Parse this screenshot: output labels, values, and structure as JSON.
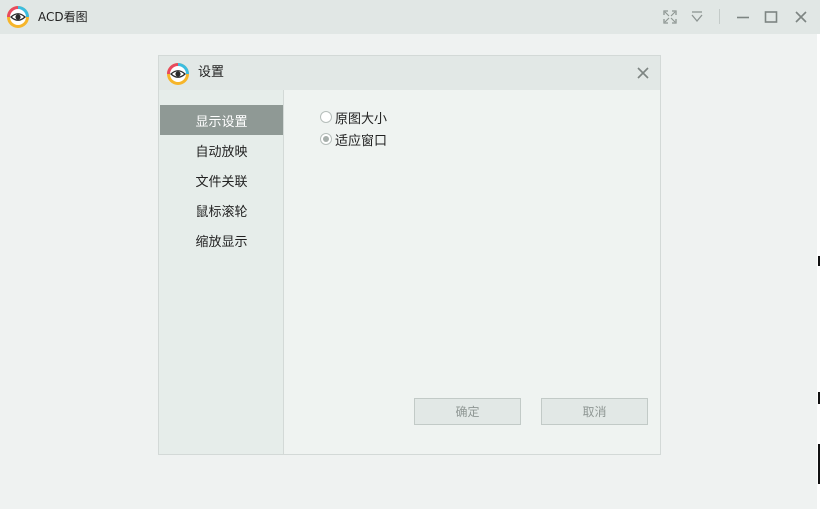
{
  "window": {
    "title": "ACD看图",
    "logo_icon": "acd-eye-logo-icon"
  },
  "dialog": {
    "title": "设置",
    "menu": [
      {
        "label": "显示设置",
        "active": true
      },
      {
        "label": "自动放映",
        "active": false
      },
      {
        "label": "文件关联",
        "active": false
      },
      {
        "label": "鼠标滚轮",
        "active": false
      },
      {
        "label": "缩放显示",
        "active": false
      }
    ],
    "options": [
      {
        "label": "原图大小",
        "checked": false
      },
      {
        "label": "适应窗口",
        "checked": true
      }
    ],
    "ok_label": "确定",
    "cancel_label": "取消"
  },
  "colors": {
    "title_bar": "#e1e7e5",
    "background": "#eff2f1",
    "active_menu": "#8f9995",
    "button_text": "#8f9794"
  }
}
